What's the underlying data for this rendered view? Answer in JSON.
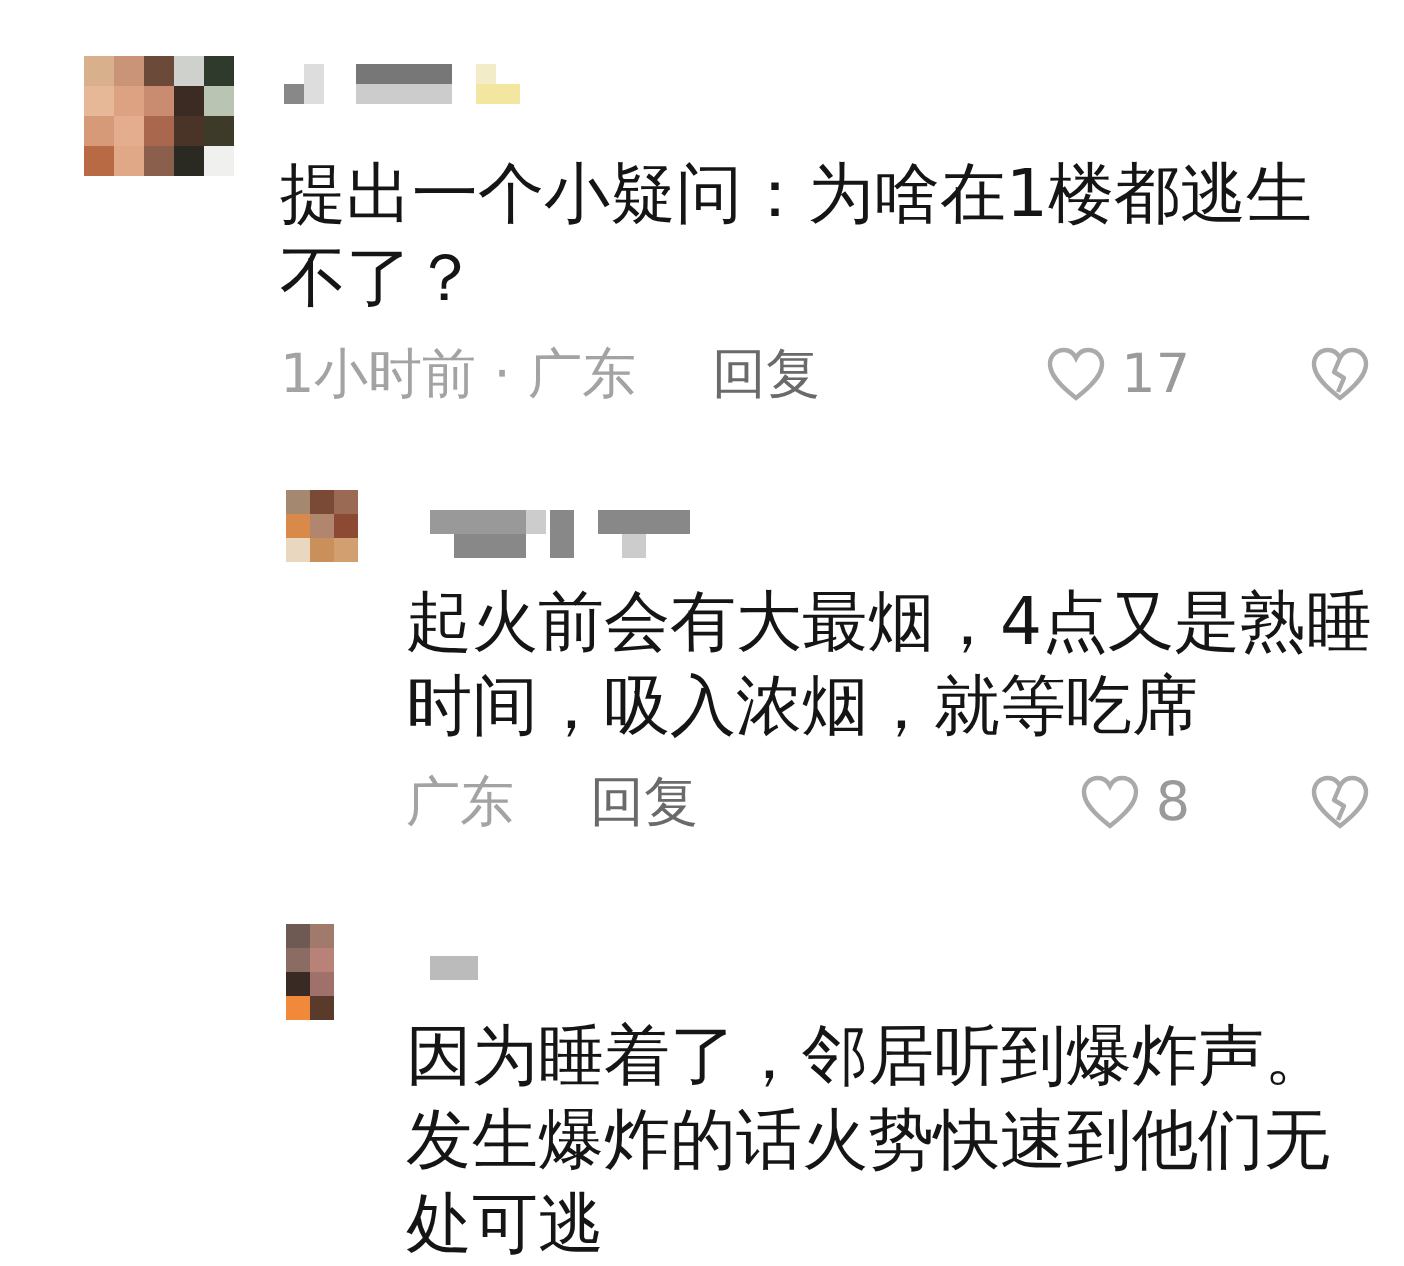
{
  "comments": [
    {
      "text": "提出一个小疑问：为啥在1楼都逃生不了？",
      "meta": "1小时前 · 广东",
      "reply_label": "回复",
      "likes": "17",
      "replies": [
        {
          "text": "起火前会有大最烟，4点又是熟睡时间，吸入浓烟，就等吃席",
          "meta": "广东",
          "reply_label": "回复",
          "likes": "8"
        },
        {
          "text": "因为睡着了，邻居听到爆炸声。发生爆炸的话火势快速到他们无处可逃"
        }
      ]
    }
  ]
}
